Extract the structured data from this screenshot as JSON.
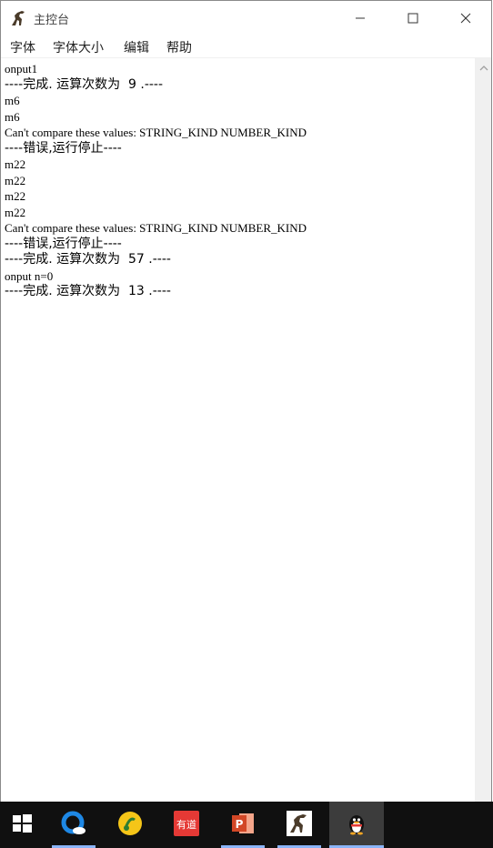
{
  "window": {
    "title": "主控台",
    "controls": {
      "minimize": "minimize",
      "maximize": "maximize",
      "close": "close"
    }
  },
  "menu": {
    "items": [
      {
        "label": "字体"
      },
      {
        "label": "字体大小"
      },
      {
        "label": "编辑"
      },
      {
        "label": "帮助"
      }
    ]
  },
  "console": {
    "lines": [
      {
        "text": "onput1",
        "style": "serif"
      },
      {
        "text": "----完成. 运算次数为  9 .----",
        "style": "cjk"
      },
      {
        "text": "m6",
        "style": "serif"
      },
      {
        "text": "m6",
        "style": "serif"
      },
      {
        "text": "Can't compare these values: STRING_KIND NUMBER_KIND",
        "style": "serif"
      },
      {
        "text": "----错误,运行停止----",
        "style": "cjk"
      },
      {
        "text": "m22",
        "style": "serif"
      },
      {
        "text": "m22",
        "style": "serif"
      },
      {
        "text": "m22",
        "style": "serif"
      },
      {
        "text": "m22",
        "style": "serif"
      },
      {
        "text": "Can't compare these values: STRING_KIND NUMBER_KIND",
        "style": "serif"
      },
      {
        "text": "----错误,运行停止----",
        "style": "cjk"
      },
      {
        "text": "----完成. 运算次数为  57 .----",
        "style": "cjk"
      },
      {
        "text": "onput n=0",
        "style": "serif"
      },
      {
        "text": "----完成. 运算次数为  13 .----",
        "style": "cjk"
      }
    ]
  },
  "taskbar": {
    "items": [
      {
        "name": "start-icon",
        "label": "start"
      },
      {
        "name": "qq-browser-icon",
        "label": "browser"
      },
      {
        "name": "qq-music-icon",
        "label": "music"
      },
      {
        "name": "youdao-icon",
        "label": "有道"
      },
      {
        "name": "powerpoint-icon",
        "label": "P"
      },
      {
        "name": "dinosaur-app-icon",
        "label": "app"
      },
      {
        "name": "qq-penguin-icon",
        "label": "qq"
      }
    ]
  },
  "colors": {
    "taskbar_bg": "#101010",
    "active_underline": "#8ab4f8",
    "youdao_red": "#e53935",
    "ppt_orange": "#d24726",
    "music_yellow": "#f5c518",
    "browser_blue": "#1e88e5"
  }
}
